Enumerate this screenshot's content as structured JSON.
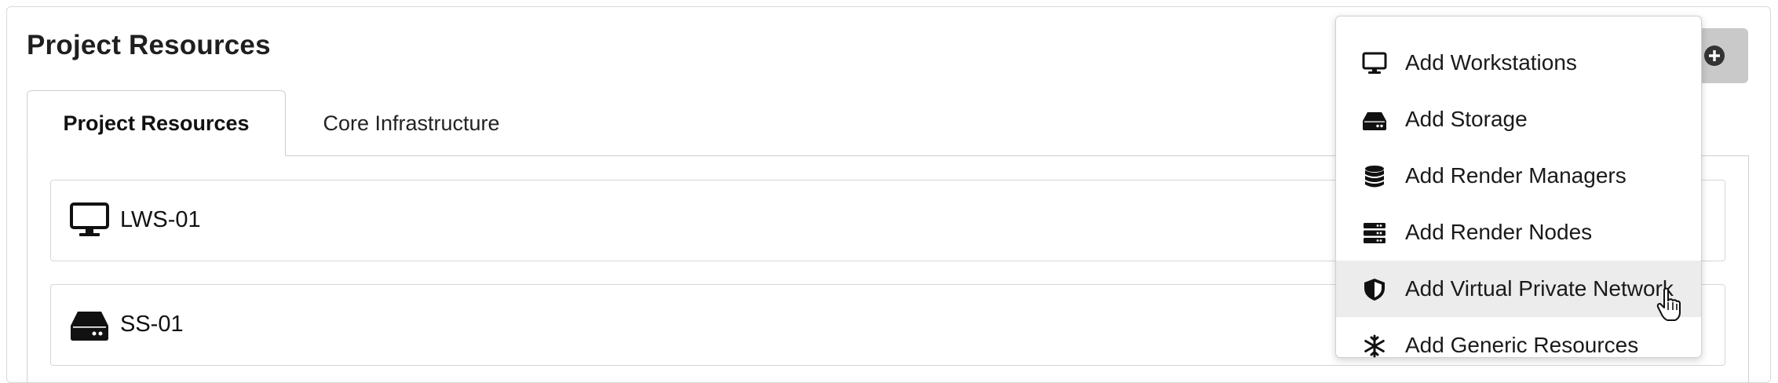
{
  "page": {
    "title": "Project Resources"
  },
  "tabs": [
    {
      "label": "Project Resources",
      "active": true
    },
    {
      "label": "Core Infrastructure",
      "active": false
    }
  ],
  "resources": [
    {
      "label": "LWS-01",
      "icon": "desktop-icon"
    },
    {
      "label": "SS-01",
      "icon": "hdd-icon"
    }
  ],
  "add_button": {
    "icon": "plus-circle-icon"
  },
  "menu": {
    "items": [
      {
        "label": "Add Workstations",
        "icon": "desktop-icon"
      },
      {
        "label": "Add Storage",
        "icon": "hdd-icon"
      },
      {
        "label": "Add Render Managers",
        "icon": "database-icon"
      },
      {
        "label": "Add Render Nodes",
        "icon": "server-icon"
      },
      {
        "label": "Add Virtual Private Network",
        "icon": "shield-icon",
        "hovered": true
      },
      {
        "label": "Add Generic Resources",
        "icon": "snowflake-icon"
      }
    ]
  },
  "colors": {
    "add_button_bg": "#c9c9c9",
    "menu_hover_bg": "#ececec",
    "border": "#d6d6d6"
  }
}
